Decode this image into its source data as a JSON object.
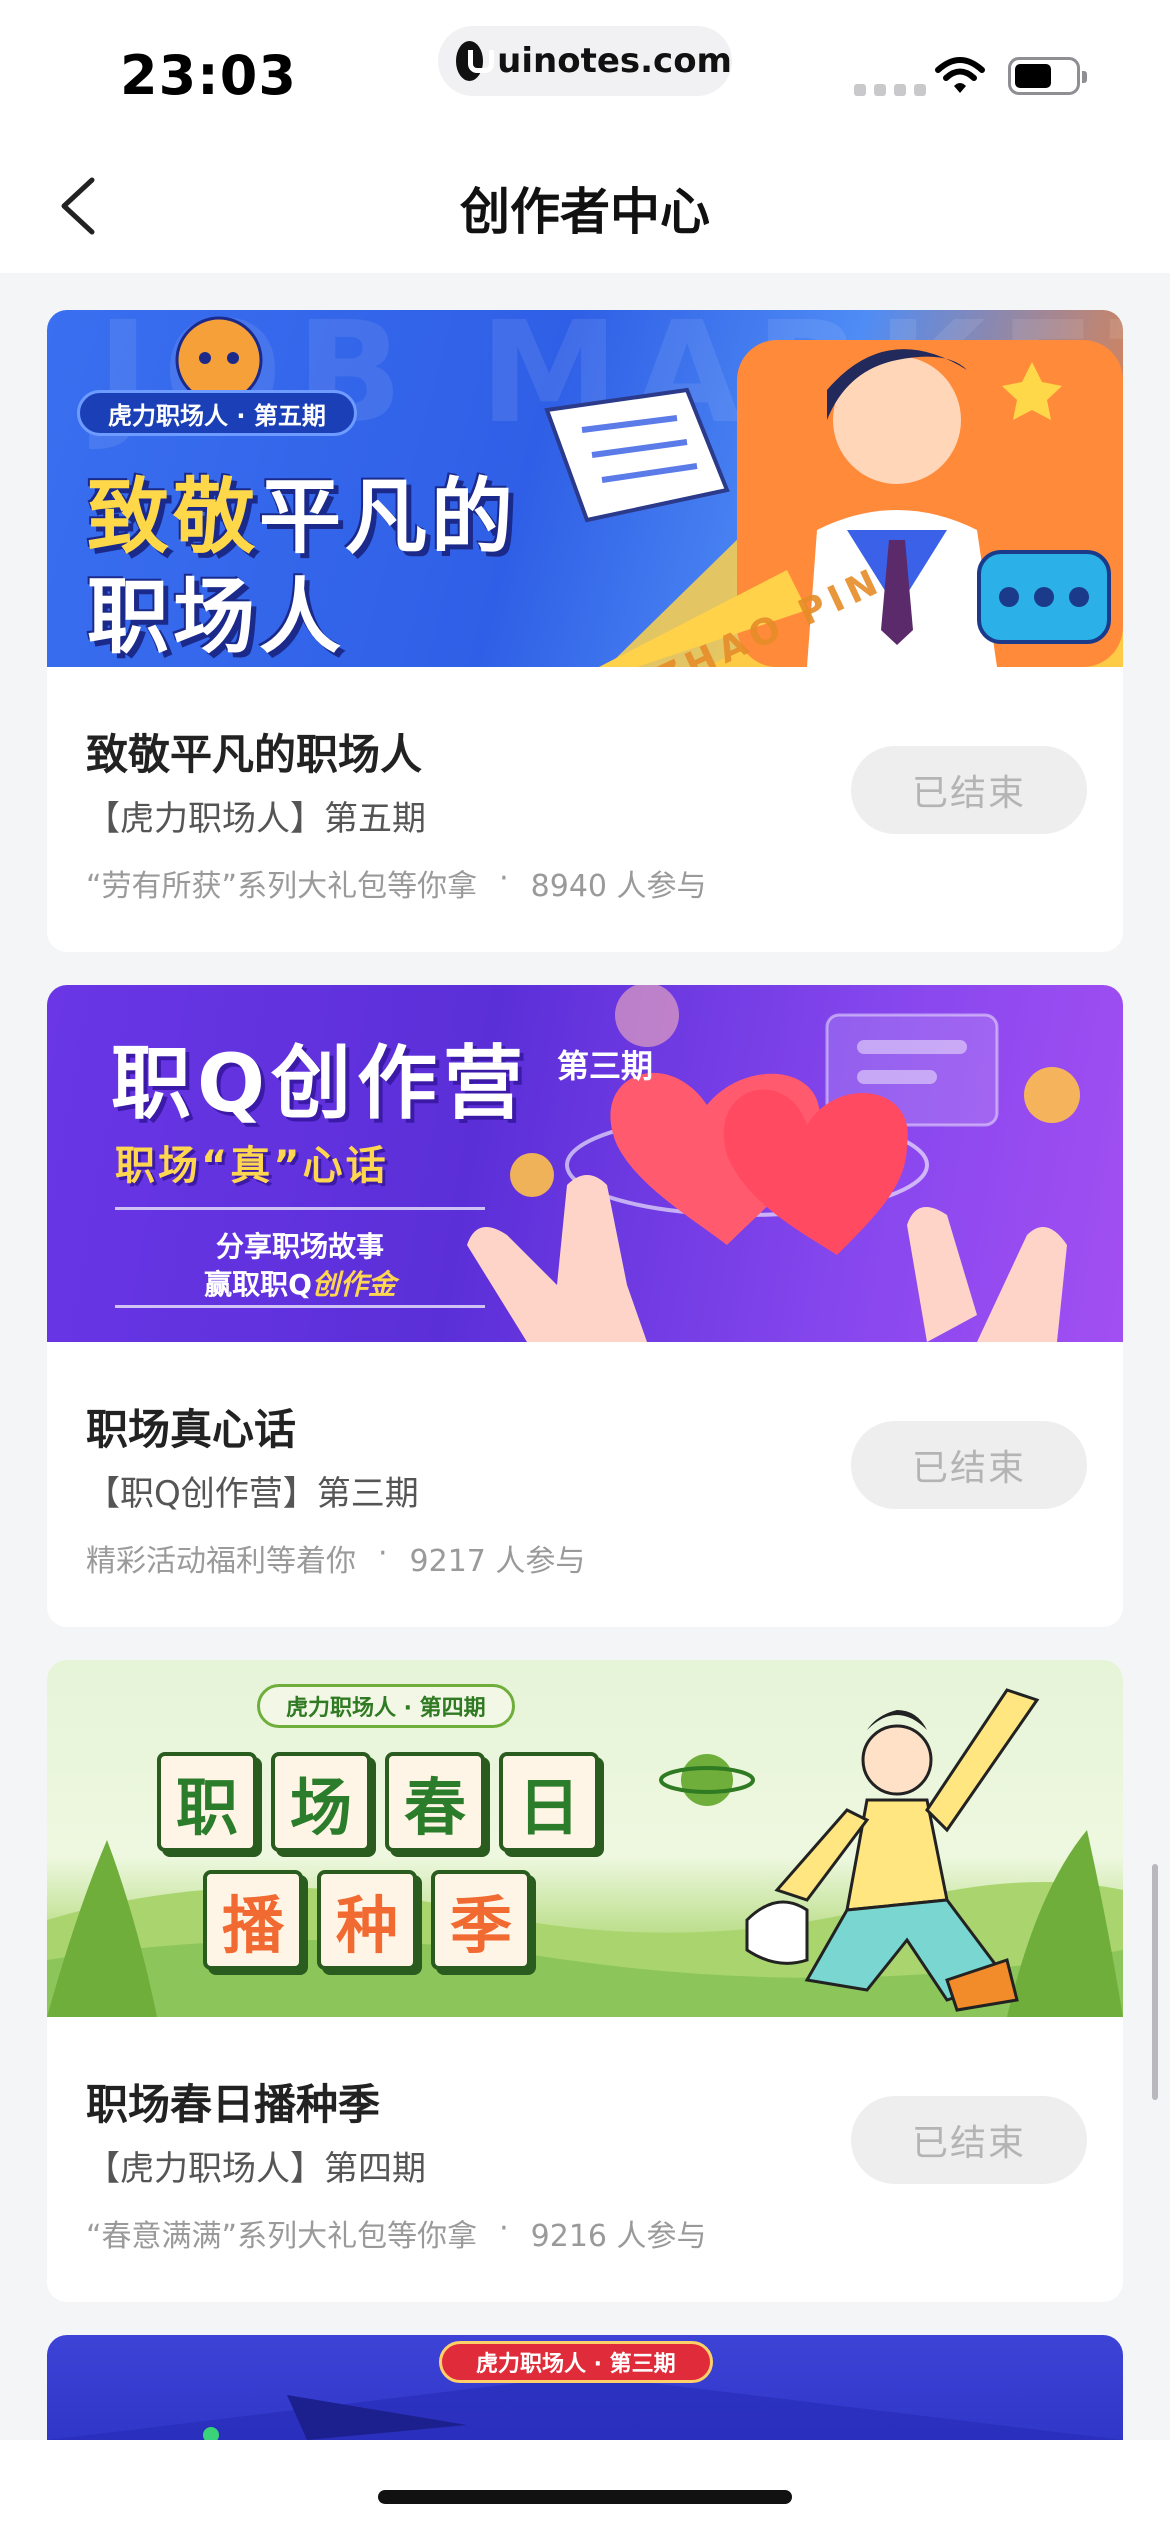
{
  "status_bar": {
    "time": "23:03",
    "url": "uinotes.com"
  },
  "nav": {
    "title": "创作者中心"
  },
  "colors": {
    "page_background": "#f4f5f7",
    "card_background": "#ffffff",
    "ended_button_bg": "#eeeeee",
    "ended_button_text": "#b4b4b4"
  },
  "events": [
    {
      "banner": {
        "bg_text": "JOB MARKET",
        "badge": "虎力职场人 · 第五期",
        "line1_a": "致敬",
        "line1_b": "平凡的",
        "line2": "职场人",
        "ribbon_text": "ZHAO PIN"
      },
      "title": "致敬平凡的职场人",
      "subtitle": "【虎力职场人】第五期",
      "reward": "“劳有所获”系列大礼包等你拿",
      "participants": "8940 人参与",
      "status": "已结束"
    },
    {
      "banner": {
        "title": "职Q创作营",
        "issue": "第三期",
        "slogan": "职场“真”心话",
        "line1": "分享职场故事",
        "line2_a": "赢取职Q",
        "line2_b": "创作金"
      },
      "title": "职场真心话",
      "subtitle": "【职Q创作营】第三期",
      "reward": "精彩活动福利等着你",
      "participants": "9217 人参与",
      "status": "已结束"
    },
    {
      "banner": {
        "badge": "虎力职场人 · 第四期",
        "tiles_row1": [
          "职",
          "场",
          "春",
          "日"
        ],
        "tiles_row2": [
          "播",
          "种",
          "季"
        ]
      },
      "title": "职场春日播种季",
      "subtitle": "【虎力职场人】第四期",
      "reward": "“春意满满”系列大礼包等你拿",
      "participants": "9216 人参与",
      "status": "已结束"
    },
    {
      "banner": {
        "badge": "虎力职场人 · 第三期"
      }
    }
  ],
  "separator": "·"
}
